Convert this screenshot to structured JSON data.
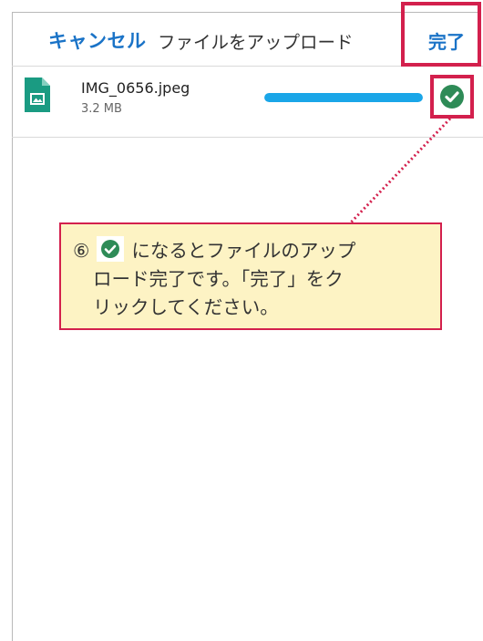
{
  "header": {
    "cancel_label": "キャンセル",
    "title": "ファイルをアップロード",
    "done_label": "完了"
  },
  "file": {
    "name": "IMG_0656.jpeg",
    "size": "3.2 MB",
    "progress_percent": 100,
    "status_icon": "check-circle-icon",
    "file_icon": "image-file-icon"
  },
  "callout": {
    "step_number": "⑥",
    "text_line1": "になるとファイルのアップ",
    "text_line2": "ロード完了です。「完了」をク",
    "text_line3": "リックしてください。"
  },
  "colors": {
    "accent_blue": "#1a73c7",
    "progress_blue": "#1aa6e8",
    "success_green": "#2e8b57",
    "highlight_red": "#d3204d",
    "callout_bg": "#fdf3c4",
    "file_icon_teal": "#1a9b82"
  }
}
